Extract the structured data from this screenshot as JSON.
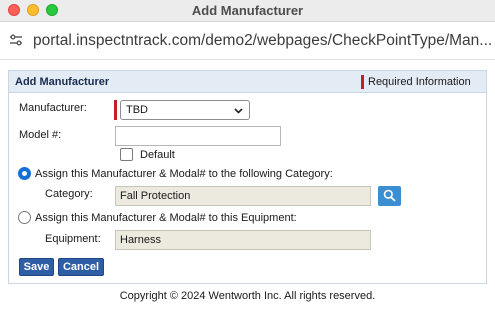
{
  "window": {
    "title": "Add Manufacturer"
  },
  "browser": {
    "url": "portal.inspectntrack.com/demo2/webpages/CheckPointType/Man..."
  },
  "panel": {
    "title": "Add Manufacturer",
    "required_info": "Required Information"
  },
  "form": {
    "manufacturer_label": "Manufacturer:",
    "manufacturer_value": "TBD",
    "model_label": "Model #:",
    "model_value": "",
    "default_label": "Default",
    "option_category_label": "Assign this Manufacturer & Modal# to the following Category:",
    "category_label": "Category:",
    "category_value": "Fall Protection",
    "option_equipment_label": "Assign this Manufacturer & Modal# to this Equipment:",
    "equipment_label": "Equipment:",
    "equipment_value": "Harness"
  },
  "buttons": {
    "save": "Save",
    "cancel": "Cancel"
  },
  "footer": {
    "copyright": "Copyright © 2024 Wentworth Inc. All rights reserved."
  },
  "colors": {
    "required_marker": "#c21f26",
    "button": "#2e5ea6",
    "header": "#e3ebf5",
    "search_button": "#3b8fd1"
  },
  "icons": {
    "url_icon": "site-settings-icon",
    "select_arrow": "chevron-down-icon",
    "search": "search-icon"
  }
}
